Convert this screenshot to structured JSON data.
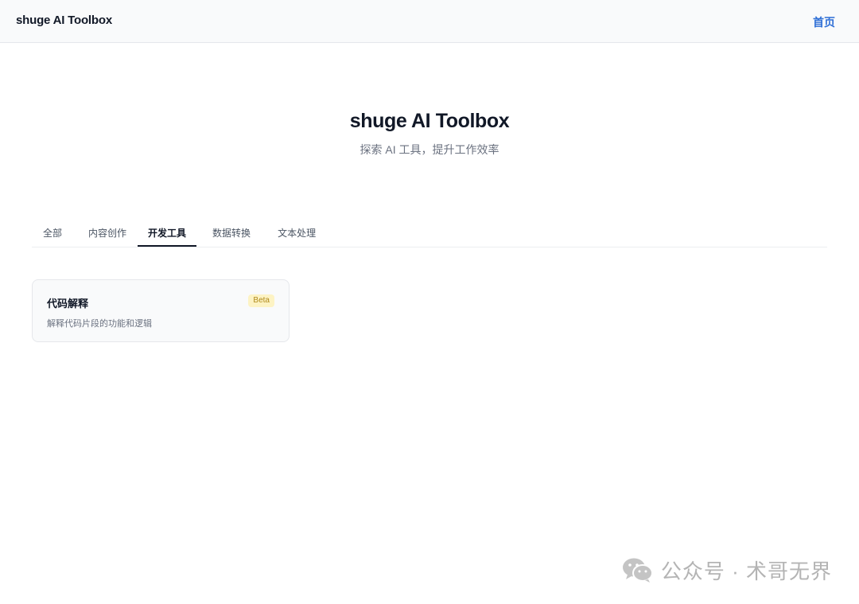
{
  "header": {
    "brand": "shuge AI Toolbox",
    "home_link": "首页"
  },
  "hero": {
    "title": "shuge AI Toolbox",
    "subtitle": "探索 AI 工具，提升工作效率"
  },
  "tabs": [
    {
      "label": "全部",
      "active": false
    },
    {
      "label": "内容创作",
      "active": false
    },
    {
      "label": "开发工具",
      "active": true
    },
    {
      "label": "数据转换",
      "active": false
    },
    {
      "label": "文本处理",
      "active": false
    }
  ],
  "cards": [
    {
      "title": "代码解释",
      "badge": "Beta",
      "description": "解释代码片段的功能和逻辑"
    }
  ],
  "watermark": {
    "text": "公众号 · 术哥无界",
    "icon": "wechat-icon"
  },
  "colors": {
    "accent": "#2f6fd6",
    "badge_bg": "#fdf3c4",
    "badge_text": "#b08a1b",
    "active_tab": "#111827"
  }
}
